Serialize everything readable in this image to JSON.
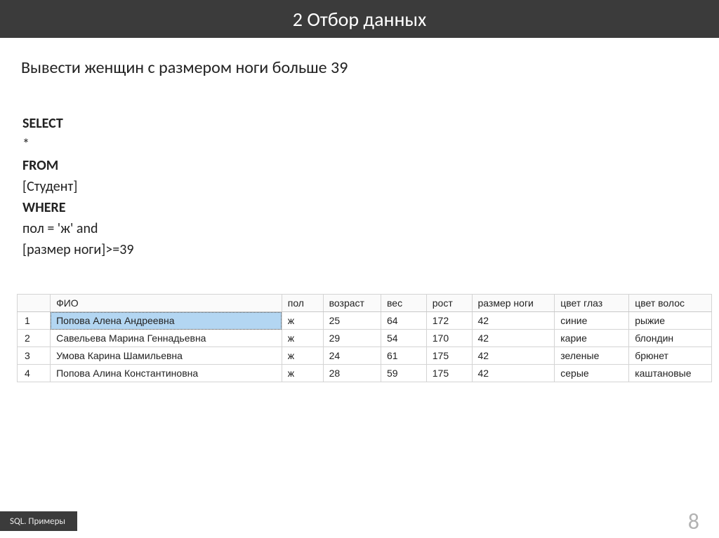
{
  "title": "2 Отбор данных",
  "task": "Вывести женщин с размером ноги больше 39",
  "query": {
    "select_kw": "SELECT",
    "select_list": "*",
    "from_kw": "FROM",
    "from_table": "[Студент]",
    "where_kw": "WHERE",
    "where_line1": "пол = 'ж' and",
    "where_line2": "[размер ноги]>=39"
  },
  "table": {
    "headers": {
      "blank": "",
      "fio": "ФИО",
      "pol": "пол",
      "age": "возраст",
      "ves": "вес",
      "rost": "рост",
      "foot": "размер ноги",
      "eye": "цвет глаз",
      "hair": "цвет волос"
    },
    "rows": [
      {
        "n": "1",
        "fio": "Попова Алена Андреевна",
        "pol": "ж",
        "age": "25",
        "ves": "64",
        "rost": "172",
        "foot": "42",
        "eye": "синие",
        "hair": "рыжие",
        "selected": true
      },
      {
        "n": "2",
        "fio": "Савельева Марина Геннадьевна",
        "pol": "ж",
        "age": "29",
        "ves": "54",
        "rost": "170",
        "foot": "42",
        "eye": "карие",
        "hair": "блондин",
        "selected": false
      },
      {
        "n": "3",
        "fio": "Умова Карина Шамильевна",
        "pol": "ж",
        "age": "24",
        "ves": "61",
        "rost": "175",
        "foot": "42",
        "eye": "зеленые",
        "hair": "брюнет",
        "selected": false
      },
      {
        "n": "4",
        "fio": "Попова Алина Константиновна",
        "pol": "ж",
        "age": "28",
        "ves": "59",
        "rost": "175",
        "foot": "42",
        "eye": "серые",
        "hair": "каштановые",
        "selected": false
      }
    ]
  },
  "footer": {
    "label": "SQL. Примеры",
    "page": "8"
  }
}
